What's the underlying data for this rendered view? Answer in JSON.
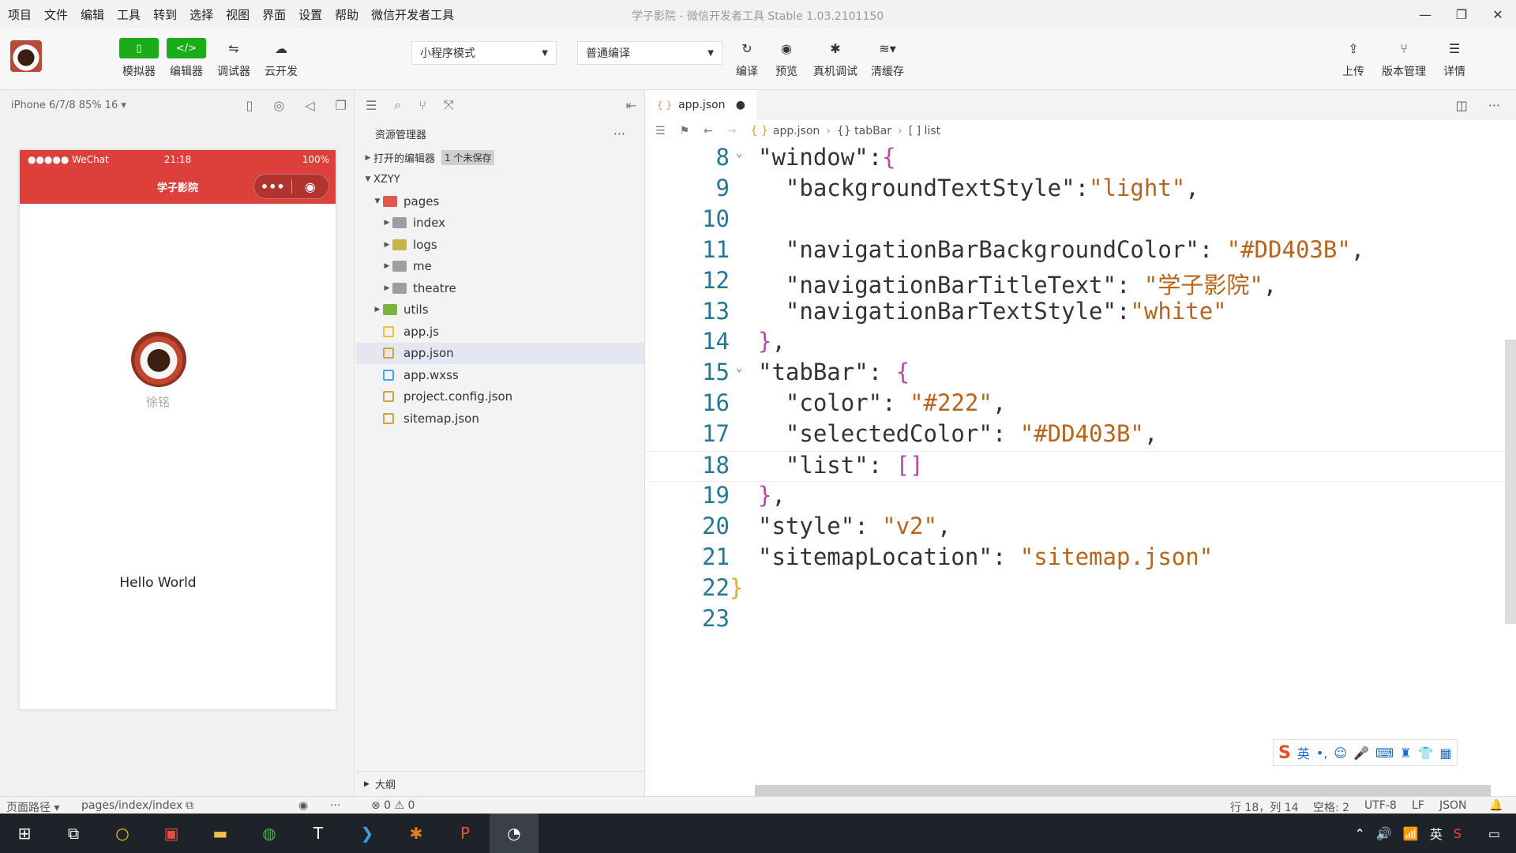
{
  "menubar": {
    "items": [
      "项目",
      "文件",
      "编辑",
      "工具",
      "转到",
      "选择",
      "视图",
      "界面",
      "设置",
      "帮助",
      "微信开发者工具"
    ],
    "title": "学子影院 - 微信开发者工具 Stable 1.03.2101150"
  },
  "toolbar": {
    "simulator": "模拟器",
    "editor": "编辑器",
    "debugger": "调试器",
    "cloud": "云开发",
    "mode_select": "小程序模式",
    "compile_select": "普通编译",
    "compile": "编译",
    "preview": "预览",
    "device_debug": "真机调试",
    "clear_cache": "清缓存",
    "upload": "上传",
    "version": "版本管理",
    "details": "详情"
  },
  "simulator": {
    "device": "iPhone 6/7/8 85% 16 ▾",
    "status_signal": "●●●●● WeChat",
    "status_time": "21:18",
    "status_battery": "100%",
    "nav_title": "学子影院",
    "user_name": "徐铭",
    "hello": "Hello World"
  },
  "explorer": {
    "title": "资源管理器",
    "open_editors": "打开的编辑器",
    "unsaved_badge": "1 个未保存",
    "root": "XZYY",
    "tree": [
      {
        "label": "pages",
        "depth": 1,
        "expanded": true,
        "icon": "folder-red"
      },
      {
        "label": "index",
        "depth": 2,
        "icon": "folder-gray"
      },
      {
        "label": "logs",
        "depth": 2,
        "icon": "folder-yellow"
      },
      {
        "label": "me",
        "depth": 2,
        "icon": "folder-gray"
      },
      {
        "label": "theatre",
        "depth": 2,
        "icon": "folder-gray"
      },
      {
        "label": "utils",
        "depth": 1,
        "icon": "folder-green"
      },
      {
        "label": "app.js",
        "depth": 1,
        "icon": "js-file"
      },
      {
        "label": "app.json",
        "depth": 1,
        "icon": "json-file",
        "selected": true
      },
      {
        "label": "app.wxss",
        "depth": 1,
        "icon": "css-file"
      },
      {
        "label": "project.config.json",
        "depth": 1,
        "icon": "json-file"
      },
      {
        "label": "sitemap.json",
        "depth": 1,
        "icon": "json-file"
      }
    ],
    "outline": "大纲"
  },
  "editor": {
    "tab": "app.json",
    "crumbs": [
      "app.json",
      "{} tabBar",
      "[ ] list"
    ],
    "lines": [
      {
        "n": "8",
        "text": "\"window\":{"
      },
      {
        "n": "9",
        "text": "  \"backgroundTextStyle\":\"light\","
      },
      {
        "n": "10",
        "text": ""
      },
      {
        "n": "11",
        "text": "  \"navigationBarBackgroundColor\": \"#DD403B\","
      },
      {
        "n": "12",
        "text": "  \"navigationBarTitleText\": \"学子影院\","
      },
      {
        "n": "13",
        "text": "  \"navigationBarTextStyle\":\"white\""
      },
      {
        "n": "14",
        "text": "},"
      },
      {
        "n": "15",
        "text": "\"tabBar\": {"
      },
      {
        "n": "16",
        "text": "  \"color\": \"#222\","
      },
      {
        "n": "17",
        "text": "  \"selectedColor\": \"#DD403B\","
      },
      {
        "n": "18",
        "text": "  \"list\": []"
      },
      {
        "n": "19",
        "text": "},"
      },
      {
        "n": "20",
        "text": "\"style\": \"v2\","
      },
      {
        "n": "21",
        "text": "\"sitemapLocation\": \"sitemap.json\""
      },
      {
        "n": "22",
        "text": "}"
      },
      {
        "n": "23",
        "text": ""
      }
    ]
  },
  "ime": {
    "label": "英"
  },
  "statusbar": {
    "page_path_label": "页面路径 ▾",
    "page_path": "pages/index/index",
    "errors": "⊗ 0 ⚠ 0",
    "position": "行 18，列 14",
    "spaces": "空格: 2",
    "encoding": "UTF-8",
    "eol": "LF",
    "language": "JSON"
  },
  "taskbar": {
    "ime": "英"
  },
  "colors": {
    "accent_green": "#1aad19",
    "nav_red": "#DD403B",
    "string_brown": "#b5651d"
  }
}
